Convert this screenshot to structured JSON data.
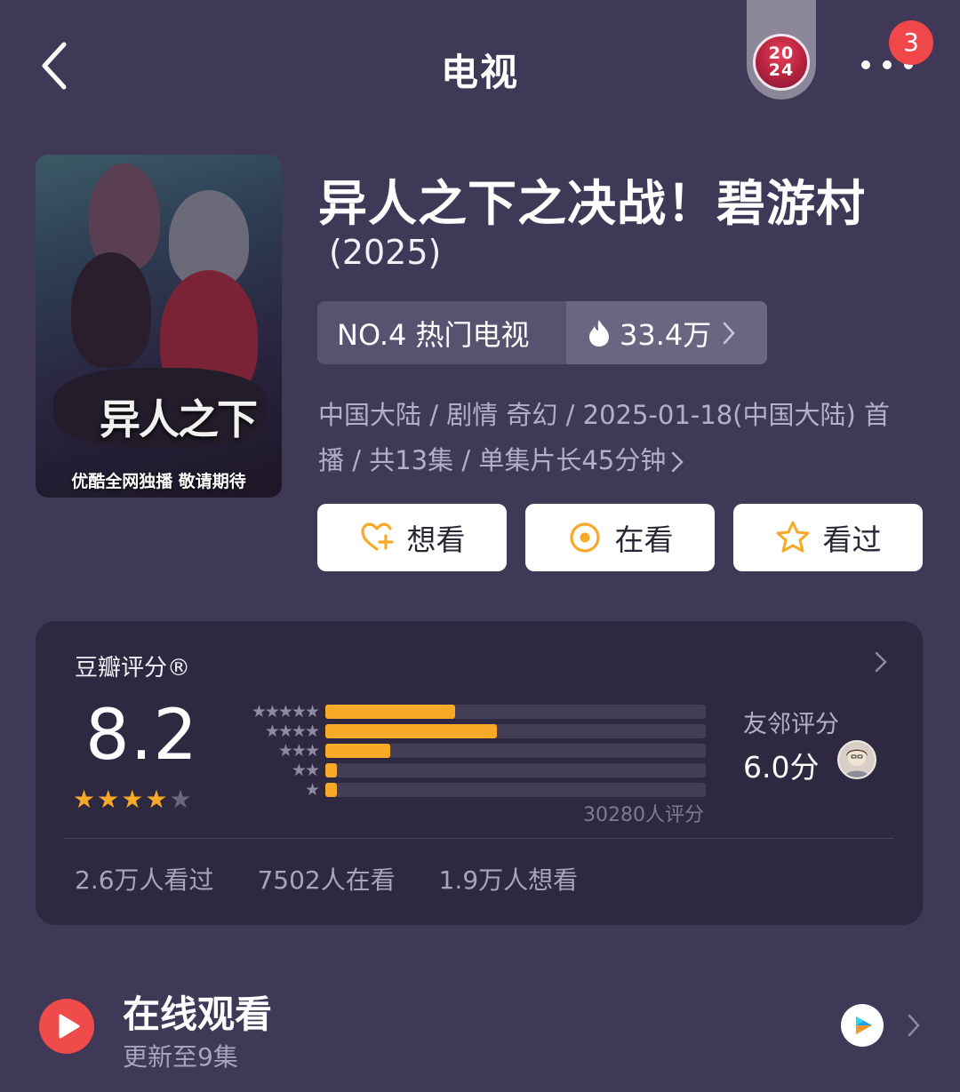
{
  "header": {
    "title": "电视",
    "year_badge": [
      "20",
      "24"
    ],
    "notification_count": "3"
  },
  "poster": {
    "logo_text": "异人之下",
    "tagline": "优酷全网独播 敬请期待"
  },
  "show": {
    "title": "异人之下之决战！碧游村",
    "year": "(2025)",
    "rank_label": "NO.4 热门电视",
    "heat": "33.4万",
    "meta_line1": "中国大陆 / 剧情 奇幻 / 2025-01-18(中国大陆) 首",
    "meta_line2": "播 / 共13集 / 单集片长45分钟"
  },
  "actions": {
    "want": "想看",
    "watching": "在看",
    "watched": "看过"
  },
  "rating": {
    "title": "豆瓣评分®",
    "score": "8.2",
    "stars": 4,
    "star_rows": [
      "★★★★★",
      "★★★★",
      "★★★",
      "★★",
      "★"
    ],
    "distribution_percent": [
      34,
      45,
      17,
      3,
      3
    ],
    "count": "30280人评分",
    "friend_label": "友邻评分",
    "friend_score": "6.0分",
    "stats": [
      "2.6万人看过",
      "7502人在看",
      "1.9万人想看"
    ]
  },
  "online": {
    "title": "在线观看",
    "subtitle": "更新至9集"
  },
  "colors": {
    "background": "#3f3856",
    "card": "#2e2940",
    "accent": "#f7a928",
    "badge_red": "#f0474b"
  },
  "icons": [
    "back-icon",
    "more-icon",
    "flame-icon",
    "heart-plus-icon",
    "target-icon",
    "star-outline-icon",
    "play-icon",
    "platform-icon",
    "chevron-right-icon"
  ]
}
